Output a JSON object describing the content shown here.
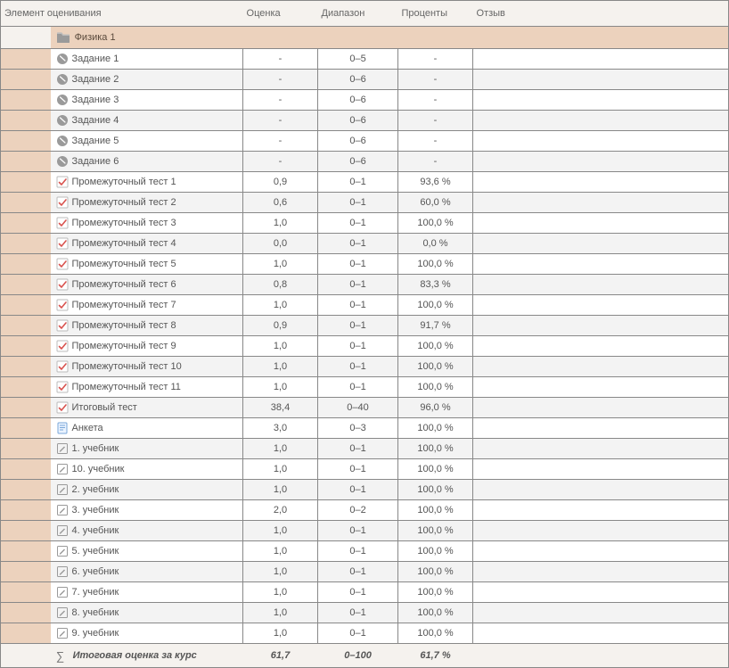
{
  "headers": {
    "item": "Элемент оценивания",
    "grade": "Оценка",
    "range": "Диапазон",
    "percent": "Проценты",
    "feedback": "Отзыв"
  },
  "category": {
    "name": "Физика 1"
  },
  "rows": [
    {
      "icon": "ball",
      "name": "Задание 1",
      "grade": "-",
      "range": "0–5",
      "percent": "-",
      "feedback": ""
    },
    {
      "icon": "ball",
      "name": "Задание 2",
      "grade": "-",
      "range": "0–6",
      "percent": "-",
      "feedback": ""
    },
    {
      "icon": "ball",
      "name": "Задание 3",
      "grade": "-",
      "range": "0–6",
      "percent": "-",
      "feedback": ""
    },
    {
      "icon": "ball",
      "name": "Задание 4",
      "grade": "-",
      "range": "0–6",
      "percent": "-",
      "feedback": ""
    },
    {
      "icon": "ball",
      "name": "Задание 5",
      "grade": "-",
      "range": "0–6",
      "percent": "-",
      "feedback": ""
    },
    {
      "icon": "ball",
      "name": "Задание 6",
      "grade": "-",
      "range": "0–6",
      "percent": "-",
      "feedback": ""
    },
    {
      "icon": "check",
      "name": "Промежуточный тест 1",
      "grade": "0,9",
      "range": "0–1",
      "percent": "93,6 %",
      "feedback": ""
    },
    {
      "icon": "check",
      "name": "Промежуточный тест 2",
      "grade": "0,6",
      "range": "0–1",
      "percent": "60,0 %",
      "feedback": ""
    },
    {
      "icon": "check",
      "name": "Промежуточный тест 3",
      "grade": "1,0",
      "range": "0–1",
      "percent": "100,0 %",
      "feedback": ""
    },
    {
      "icon": "check",
      "name": "Промежуточный тест 4",
      "grade": "0,0",
      "range": "0–1",
      "percent": "0,0 %",
      "feedback": ""
    },
    {
      "icon": "check",
      "name": "Промежуточный тест 5",
      "grade": "1,0",
      "range": "0–1",
      "percent": "100,0 %",
      "feedback": ""
    },
    {
      "icon": "check",
      "name": "Промежуточный тест 6",
      "grade": "0,8",
      "range": "0–1",
      "percent": "83,3 %",
      "feedback": ""
    },
    {
      "icon": "check",
      "name": "Промежуточный тест 7",
      "grade": "1,0",
      "range": "0–1",
      "percent": "100,0 %",
      "feedback": ""
    },
    {
      "icon": "check",
      "name": "Промежуточный тест 8",
      "grade": "0,9",
      "range": "0–1",
      "percent": "91,7 %",
      "feedback": ""
    },
    {
      "icon": "check",
      "name": "Промежуточный тест 9",
      "grade": "1,0",
      "range": "0–1",
      "percent": "100,0 %",
      "feedback": ""
    },
    {
      "icon": "check",
      "name": "Промежуточный тест 10",
      "grade": "1,0",
      "range": "0–1",
      "percent": "100,0 %",
      "feedback": ""
    },
    {
      "icon": "check",
      "name": "Промежуточный тест 11",
      "grade": "1,0",
      "range": "0–1",
      "percent": "100,0 %",
      "feedback": ""
    },
    {
      "icon": "check",
      "name": "Итоговый тест",
      "grade": "38,4",
      "range": "0–40",
      "percent": "96,0 %",
      "feedback": ""
    },
    {
      "icon": "note",
      "name": "Анкета",
      "grade": "3,0",
      "range": "0–3",
      "percent": "100,0 %",
      "feedback": ""
    },
    {
      "icon": "edit",
      "name": "1. учебник",
      "grade": "1,0",
      "range": "0–1",
      "percent": "100,0 %",
      "feedback": ""
    },
    {
      "icon": "edit",
      "name": "10. учебник",
      "grade": "1,0",
      "range": "0–1",
      "percent": "100,0 %",
      "feedback": ""
    },
    {
      "icon": "edit",
      "name": "2. учебник",
      "grade": "1,0",
      "range": "0–1",
      "percent": "100,0 %",
      "feedback": ""
    },
    {
      "icon": "edit",
      "name": "3. учебник",
      "grade": "2,0",
      "range": "0–2",
      "percent": "100,0 %",
      "feedback": ""
    },
    {
      "icon": "edit",
      "name": "4. учебник",
      "grade": "1,0",
      "range": "0–1",
      "percent": "100,0 %",
      "feedback": ""
    },
    {
      "icon": "edit",
      "name": "5. учебник",
      "grade": "1,0",
      "range": "0–1",
      "percent": "100,0 %",
      "feedback": ""
    },
    {
      "icon": "edit",
      "name": "6. учебник",
      "grade": "1,0",
      "range": "0–1",
      "percent": "100,0 %",
      "feedback": ""
    },
    {
      "icon": "edit",
      "name": "7. учебник",
      "grade": "1,0",
      "range": "0–1",
      "percent": "100,0 %",
      "feedback": ""
    },
    {
      "icon": "edit",
      "name": "8. учебник",
      "grade": "1,0",
      "range": "0–1",
      "percent": "100,0 %",
      "feedback": ""
    },
    {
      "icon": "edit",
      "name": "9. учебник",
      "grade": "1,0",
      "range": "0–1",
      "percent": "100,0 %",
      "feedback": ""
    }
  ],
  "final": {
    "label": "Итоговая оценка за курс",
    "grade": "61,7",
    "range": "0–100",
    "percent": "61,7 %"
  }
}
